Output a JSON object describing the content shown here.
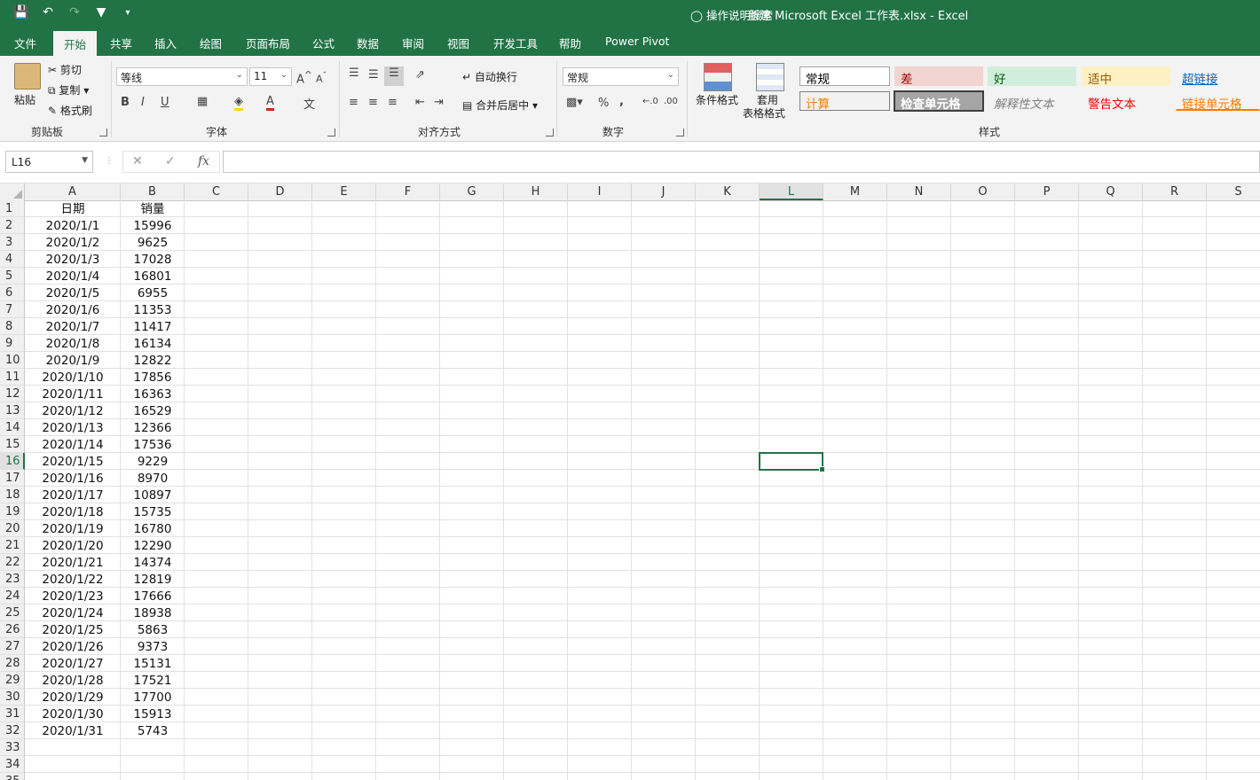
{
  "window": {
    "title": "新建 Microsoft Excel 工作表.xlsx  -  Excel"
  },
  "qat": {
    "save_icon": "save-icon",
    "undo_icon": "undo-icon",
    "redo_icon": "redo-icon",
    "filter_icon": "filter-icon",
    "customize_icon": "customize-icon"
  },
  "tabs": [
    "文件",
    "开始",
    "共享",
    "插入",
    "绘图",
    "页面布局",
    "公式",
    "数据",
    "审阅",
    "视图",
    "开发工具",
    "帮助",
    "Power Pivot"
  ],
  "active_tab": "开始",
  "tell_me": "操作说明搜索",
  "ribbon": {
    "clipboard": {
      "paste": "粘贴",
      "cut": "剪切",
      "copy": "复制",
      "format_painter": "格式刷",
      "label": "剪贴板"
    },
    "font": {
      "font_name": "等线",
      "font_size": "11",
      "label": "字体",
      "bold": "B",
      "italic": "I",
      "underline": "U"
    },
    "alignment": {
      "wrap_text": "自动换行",
      "merge_center": "合并后居中",
      "label": "对齐方式"
    },
    "number": {
      "format": "常规",
      "percent": "%",
      "comma": ",",
      "label": "数字"
    },
    "styles": {
      "conditional_format": "条件格式",
      "table_format_1": "套用",
      "table_format_2": "表格格式",
      "label": "样式",
      "cells": [
        {
          "text": "常规",
          "bg": "#ffffff",
          "fg": "#000000",
          "border": "#a6a6a6"
        },
        {
          "text": "差",
          "bg": "#f2d4d0",
          "fg": "#9c0006",
          "border": "#f2d4d0"
        },
        {
          "text": "好",
          "bg": "#d1eedc",
          "fg": "#006100",
          "border": "#d1eedc"
        },
        {
          "text": "适中",
          "bg": "#fdf1c4",
          "fg": "#9c5700",
          "border": "#fdf1c4"
        },
        {
          "text": "超链接",
          "bg": "#f3f3f3",
          "fg": "#0563c1",
          "border": "#f3f3f3"
        },
        {
          "text": "计算",
          "bg": "#f2f2f2",
          "fg": "#fa7d00",
          "border": "#7f7f7f"
        },
        {
          "text": "检查单元格",
          "bg": "#a5a5a5",
          "fg": "#ffffff",
          "border": "#3f3f3f"
        },
        {
          "text": "解释性文本",
          "bg": "#f3f3f3",
          "fg": "#7f7f7f",
          "border": "#f3f3f3"
        },
        {
          "text": "警告文本",
          "bg": "#f3f3f3",
          "fg": "#ff0000",
          "border": "#f3f3f3"
        },
        {
          "text": "链接单元格",
          "bg": "#f3f3f3",
          "fg": "#fa7d00",
          "border": "#f3f3f3"
        }
      ]
    }
  },
  "formula_bar": {
    "name_box": "L16",
    "cancel": "✕",
    "enter": "✓",
    "fx": "fx",
    "formula": ""
  },
  "columns": [
    "A",
    "B",
    "C",
    "D",
    "E",
    "F",
    "G",
    "H",
    "I",
    "J",
    "K",
    "L",
    "M",
    "N",
    "O",
    "P",
    "Q",
    "R",
    "S"
  ],
  "selected_column": "L",
  "selected_row": 16,
  "row_count": 35,
  "sheet": {
    "header": [
      "日期",
      "销量"
    ],
    "rows": [
      [
        "2020/1/1",
        "15996"
      ],
      [
        "2020/1/2",
        "9625"
      ],
      [
        "2020/1/3",
        "17028"
      ],
      [
        "2020/1/4",
        "16801"
      ],
      [
        "2020/1/5",
        "6955"
      ],
      [
        "2020/1/6",
        "11353"
      ],
      [
        "2020/1/7",
        "11417"
      ],
      [
        "2020/1/8",
        "16134"
      ],
      [
        "2020/1/9",
        "12822"
      ],
      [
        "2020/1/10",
        "17856"
      ],
      [
        "2020/1/11",
        "16363"
      ],
      [
        "2020/1/12",
        "16529"
      ],
      [
        "2020/1/13",
        "12366"
      ],
      [
        "2020/1/14",
        "17536"
      ],
      [
        "2020/1/15",
        "9229"
      ],
      [
        "2020/1/16",
        "8970"
      ],
      [
        "2020/1/17",
        "10897"
      ],
      [
        "2020/1/18",
        "15735"
      ],
      [
        "2020/1/19",
        "16780"
      ],
      [
        "2020/1/20",
        "12290"
      ],
      [
        "2020/1/21",
        "14374"
      ],
      [
        "2020/1/22",
        "12819"
      ],
      [
        "2020/1/23",
        "17666"
      ],
      [
        "2020/1/24",
        "18938"
      ],
      [
        "2020/1/25",
        "5863"
      ],
      [
        "2020/1/26",
        "9373"
      ],
      [
        "2020/1/27",
        "15131"
      ],
      [
        "2020/1/28",
        "17521"
      ],
      [
        "2020/1/29",
        "17700"
      ],
      [
        "2020/1/30",
        "15913"
      ],
      [
        "2020/1/31",
        "5743"
      ]
    ]
  }
}
